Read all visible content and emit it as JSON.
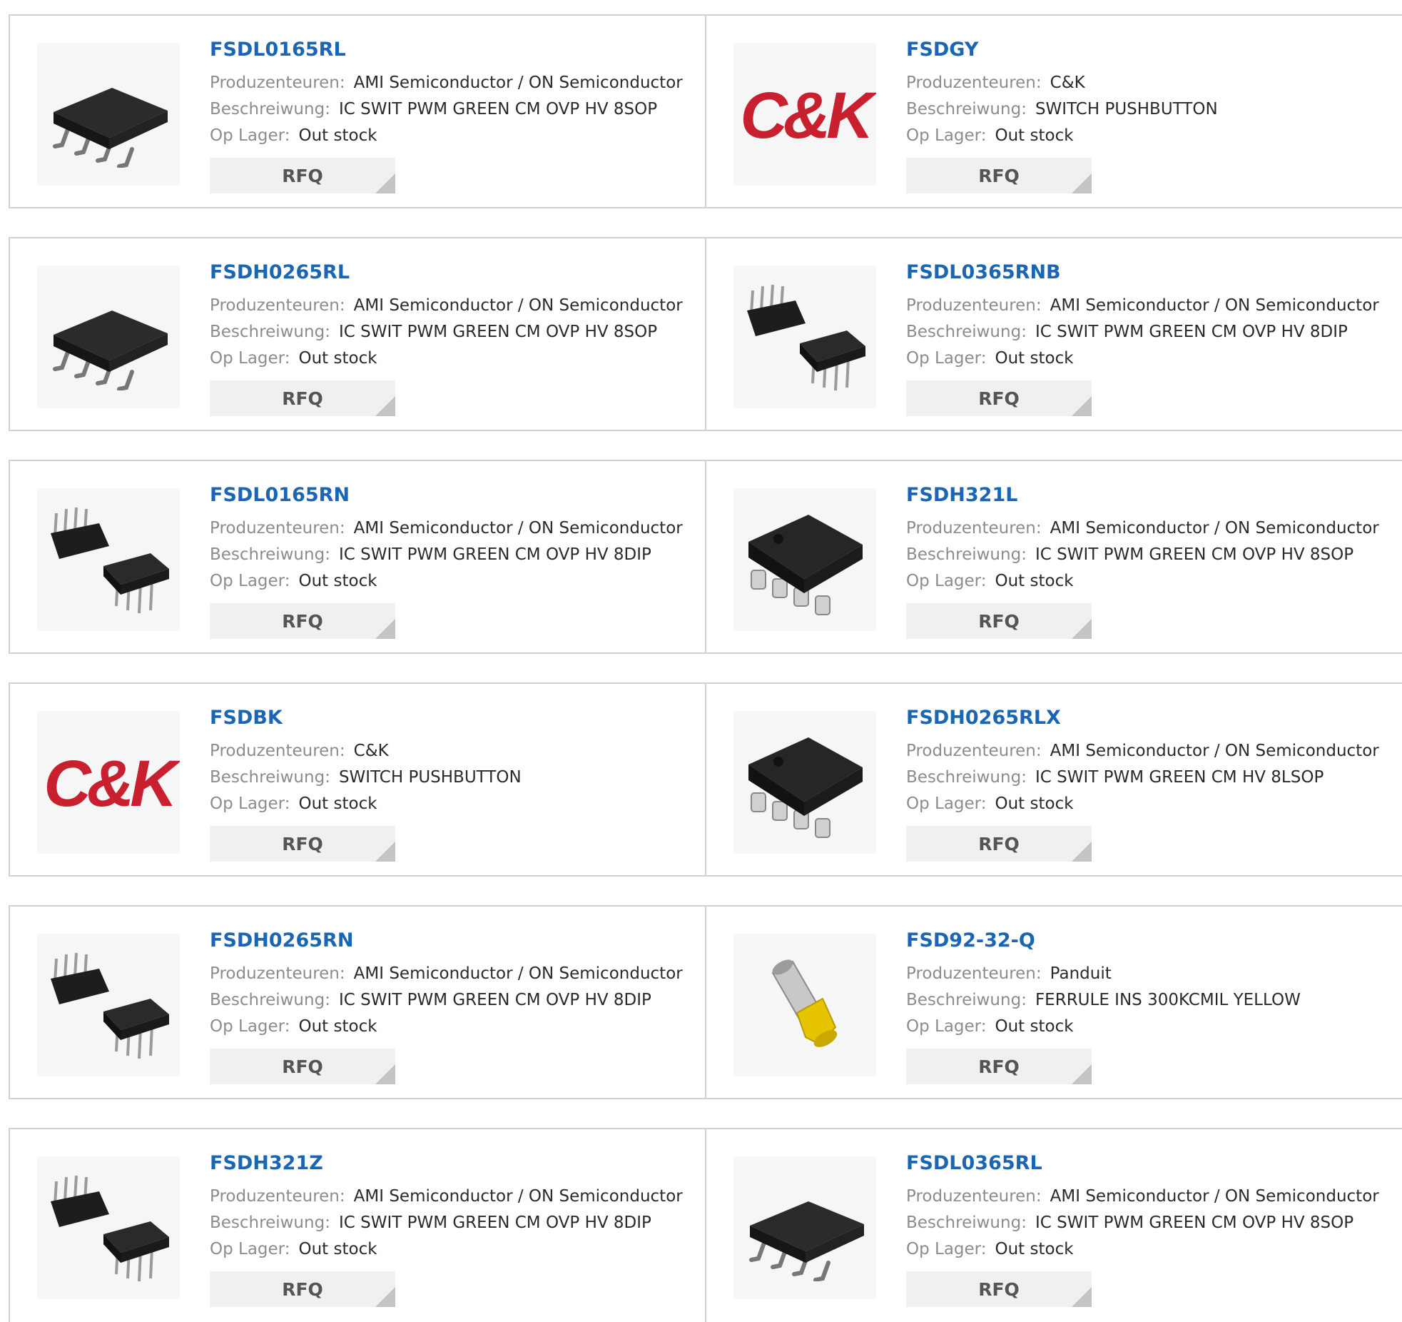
{
  "labels": {
    "manufacturer": "Produzenteuren:",
    "description": "Beschreiwung:",
    "stock": "Op Lager:",
    "rfq": "RFQ"
  },
  "colors": {
    "link": "#1a66b4",
    "ck_red": "#c8202f"
  },
  "products": [
    {
      "part": "FSDL0165RL",
      "manufacturer": "AMI Semiconductor / ON Semiconductor",
      "description": "IC SWIT PWM GREEN CM OVP HV 8SOP",
      "stock": "Out stock",
      "image": "sop8-chip-icon"
    },
    {
      "part": "FSDGY",
      "manufacturer": "C&K",
      "description": "SWITCH PUSHBUTTON",
      "stock": "Out stock",
      "image": "ck-logo"
    },
    {
      "part": "FSDH0265RL",
      "manufacturer": "AMI Semiconductor / ON Semiconductor",
      "description": "IC SWIT PWM GREEN CM OVP HV 8SOP",
      "stock": "Out stock",
      "image": "sop8-chip-icon"
    },
    {
      "part": "FSDL0365RNB",
      "manufacturer": "AMI Semiconductor / ON Semiconductor",
      "description": "IC SWIT PWM GREEN CM OVP HV 8DIP",
      "stock": "Out stock",
      "image": "dip8-chip-icon"
    },
    {
      "part": "FSDL0165RN",
      "manufacturer": "AMI Semiconductor / ON Semiconductor",
      "description": "IC SWIT PWM GREEN CM OVP HV 8DIP",
      "stock": "Out stock",
      "image": "dip8-chip-icon"
    },
    {
      "part": "FSDH321L",
      "manufacturer": "AMI Semiconductor / ON Semiconductor",
      "description": "IC SWIT PWM GREEN CM OVP HV 8SOP",
      "stock": "Out stock",
      "image": "soic8-chip-icon"
    },
    {
      "part": "FSDBK",
      "manufacturer": "C&K",
      "description": "SWITCH PUSHBUTTON",
      "stock": "Out stock",
      "image": "ck-logo"
    },
    {
      "part": "FSDH0265RLX",
      "manufacturer": "AMI Semiconductor / ON Semiconductor",
      "description": "IC SWIT PWM GREEN CM HV 8LSOP",
      "stock": "Out stock",
      "image": "soic8-chip-icon"
    },
    {
      "part": "FSDH0265RN",
      "manufacturer": "AMI Semiconductor / ON Semiconductor",
      "description": "IC SWIT PWM GREEN CM OVP HV 8DIP",
      "stock": "Out stock",
      "image": "dip8-chip-icon"
    },
    {
      "part": "FSD92-32-Q",
      "manufacturer": "Panduit",
      "description": "FERRULE INS 300KCMIL YELLOW",
      "stock": "Out stock",
      "image": "ferrule-icon"
    },
    {
      "part": "FSDH321Z",
      "manufacturer": "AMI Semiconductor / ON Semiconductor",
      "description": "IC SWIT PWM GREEN CM OVP HV 8DIP",
      "stock": "Out stock",
      "image": "dip8-chip-icon"
    },
    {
      "part": "FSDL0365RL",
      "manufacturer": "AMI Semiconductor / ON Semiconductor",
      "description": "IC SWIT PWM GREEN CM OVP HV 8SOP",
      "stock": "Out stock",
      "image": "sop8-chip-icon"
    }
  ]
}
